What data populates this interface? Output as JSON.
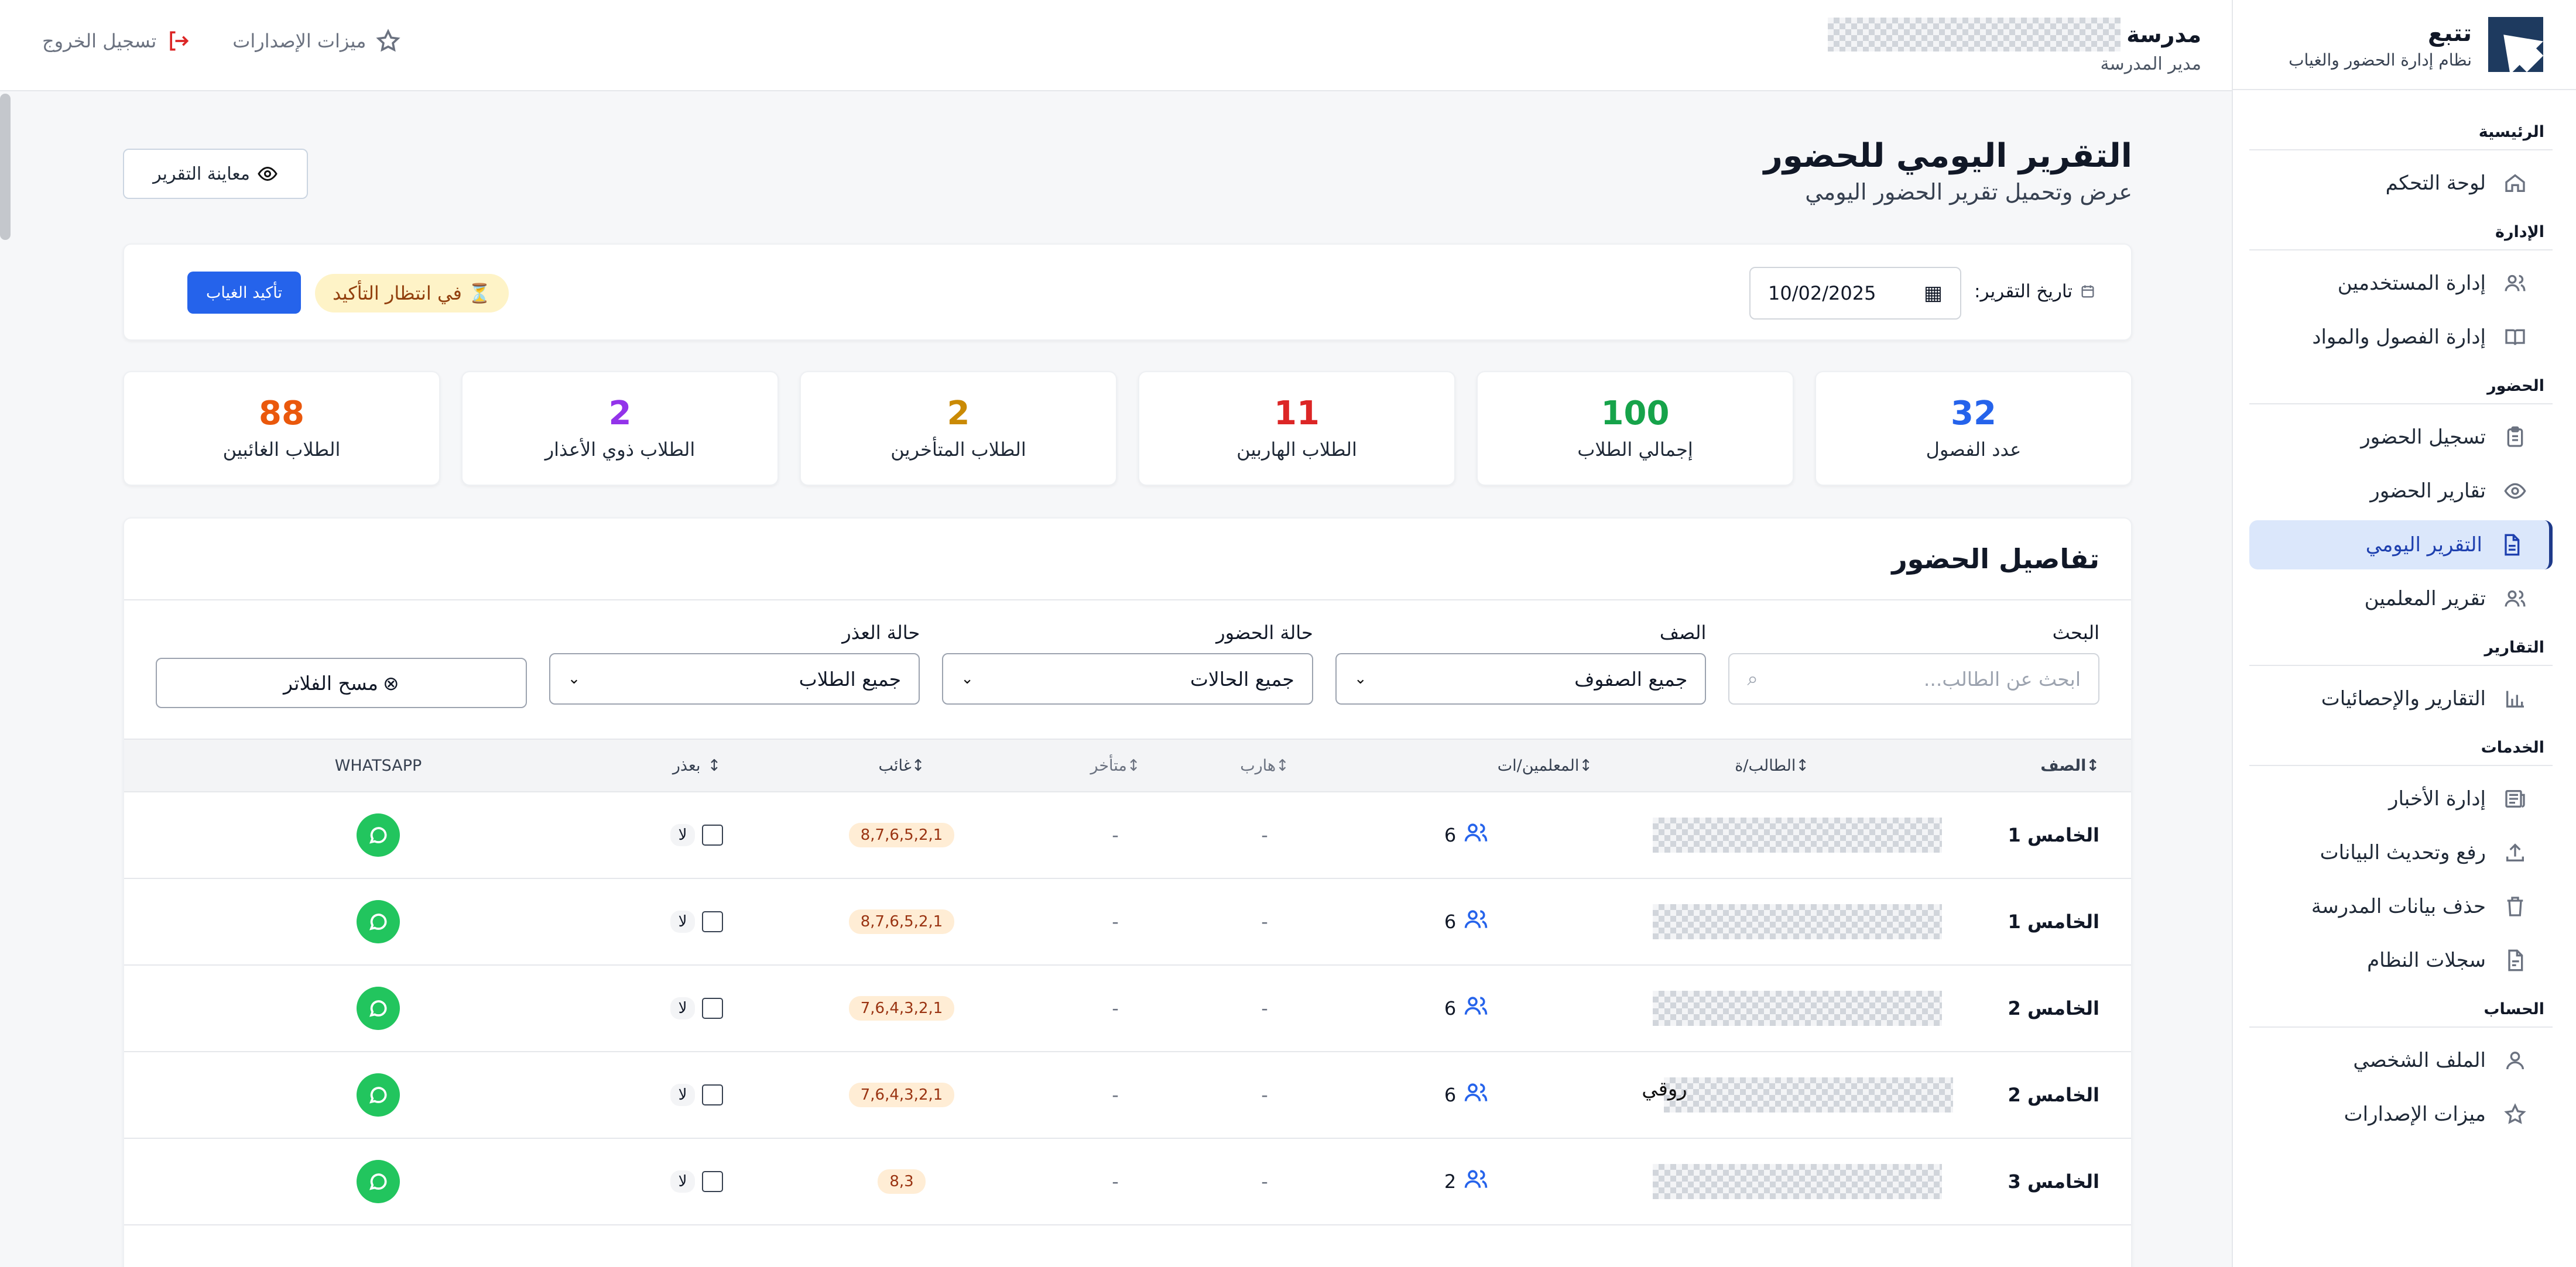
{
  "brand": {
    "name": "تتبع",
    "subtitle": "نظام إدارة الحضور والغياب"
  },
  "sidebar": {
    "sections": [
      {
        "title": "الرئيسية",
        "items": [
          {
            "label": "لوحة التحكم",
            "icon": "home-icon"
          }
        ]
      },
      {
        "title": "الإدارة",
        "items": [
          {
            "label": "إدارة المستخدمين",
            "icon": "users-icon"
          },
          {
            "label": "إدارة الفصول والمواد",
            "icon": "book-icon"
          }
        ]
      },
      {
        "title": "الحضور",
        "items": [
          {
            "label": "تسجيل الحضور",
            "icon": "clipboard-icon"
          },
          {
            "label": "تقارير الحضور",
            "icon": "eye-icon"
          },
          {
            "label": "التقرير اليومي",
            "icon": "document-icon",
            "active": true
          },
          {
            "label": "تقرير المعلمين",
            "icon": "users-icon"
          }
        ]
      },
      {
        "title": "التقارير",
        "items": [
          {
            "label": "التقارير والإحصائيات",
            "icon": "bar-chart-icon"
          }
        ]
      },
      {
        "title": "الخدمات",
        "items": [
          {
            "label": "إدارة الأخبار",
            "icon": "newspaper-icon"
          },
          {
            "label": "رفع وتحديث البيانات",
            "icon": "upload-icon"
          },
          {
            "label": "حذف بيانات المدرسة",
            "icon": "trash-icon"
          },
          {
            "label": "سجلات النظام",
            "icon": "file-icon"
          }
        ]
      },
      {
        "title": "الحساب",
        "items": [
          {
            "label": "الملف الشخصي",
            "icon": "user-icon"
          },
          {
            "label": "ميزات الإصدارات",
            "icon": "star-icon"
          }
        ]
      }
    ]
  },
  "topbar": {
    "school_label": "مدرسة",
    "role": "مدير المدرسة",
    "releases": "ميزات الإصدارات",
    "logout": "تسجيل الخروج"
  },
  "page": {
    "title": "التقرير اليومي للحضور",
    "subtitle": "عرض وتحميل تقرير الحضور اليومي",
    "preview": "معاينة التقرير"
  },
  "datebar": {
    "label": "تاريخ التقرير:",
    "date": "10/02/2025",
    "status": "في انتظار التأكيد",
    "confirm": "تأكيد الغياب"
  },
  "stats": [
    {
      "value": "32",
      "label": "عدد الفصول",
      "color": "#2563eb"
    },
    {
      "value": "100",
      "label": "إجمالي الطلاب",
      "color": "#16a34a"
    },
    {
      "value": "11",
      "label": "الطلاب الهاربين",
      "color": "#dc2626"
    },
    {
      "value": "2",
      "label": "الطلاب المتأخرين",
      "color": "#ca8a04"
    },
    {
      "value": "2",
      "label": "الطلاب ذوي الأعذار",
      "color": "#9333ea"
    },
    {
      "value": "88",
      "label": "الطلاب الغائبين",
      "color": "#ea580c"
    }
  ],
  "details": {
    "title": "تفاصيل الحضور",
    "filters": {
      "search_label": "البحث",
      "search_placeholder": "ابحث عن الطالب...",
      "class_label": "الصف",
      "class_value": "جميع الصفوف",
      "attendance_label": "حالة الحضور",
      "attendance_value": "جميع الحالات",
      "excuse_label": "حالة العذر",
      "excuse_value": "جميع الطلاب",
      "clear": "مسح الفلاتر"
    },
    "columns": {
      "class": "الصف",
      "student": "الطالب/ة",
      "teachers": "المعلمين/ات",
      "escaped": "هارب",
      "late": "متأخر",
      "absent": "غائب",
      "excuse": "بعذر",
      "whatsapp": "WHATSAPP"
    },
    "rows": [
      {
        "class": "الخامس 1",
        "teachers": "6",
        "escaped": "-",
        "late": "-",
        "absent": "8,7,6,5,2,1",
        "excuse": "لا"
      },
      {
        "class": "الخامس 1",
        "teachers": "6",
        "escaped": "-",
        "late": "-",
        "absent": "8,7,6,5,2,1",
        "excuse": "لا"
      },
      {
        "class": "الخامس 2",
        "teachers": "6",
        "escaped": "-",
        "late": "-",
        "absent": "7,6,4,3,2,1",
        "excuse": "لا"
      },
      {
        "class": "الخامس 2",
        "teachers": "6",
        "escaped": "-",
        "late": "-",
        "absent": "7,6,4,3,2,1",
        "excuse": "لا",
        "suffix": "روقي"
      },
      {
        "class": "الخامس 3",
        "teachers": "2",
        "escaped": "-",
        "late": "-",
        "absent": "8,3",
        "excuse": "لا"
      }
    ]
  }
}
